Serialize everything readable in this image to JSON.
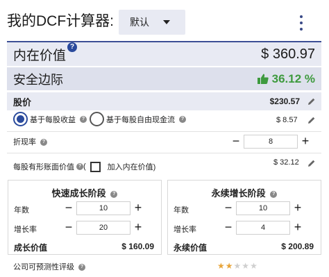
{
  "header": {
    "title": "我的DCF计算器:",
    "preset_value": "默认"
  },
  "intrinsic_value": {
    "label": "内在价值",
    "value": "$ 360.97"
  },
  "margin_of_safety": {
    "label": "安全边际",
    "value": "36.12 %",
    "color": "#3e9a3e"
  },
  "stock_price": {
    "label": "股价",
    "value": "$230.57"
  },
  "basis": {
    "option_eps": "基于每股收益",
    "option_fcf": "基于每股自由现金流",
    "selected": "eps",
    "value": "$ 8.57"
  },
  "discount_rate": {
    "label": "折现率",
    "value": "8"
  },
  "tangible_book": {
    "label": "每股有形账面价值",
    "paren_open": "(",
    "checkbox_label": "加入内在价值)",
    "value": "$ 32.12"
  },
  "growth_stage": {
    "title": "快速成长阶段",
    "years_label": "年数",
    "years_value": "10",
    "rate_label": "增长率",
    "rate_value": "20",
    "result_label": "成长价值",
    "result_value": "$ 160.09"
  },
  "terminal_stage": {
    "title": "永续增长阶段",
    "years_label": "年数",
    "years_value": "10",
    "rate_label": "增长率",
    "rate_value": "4",
    "result_label": "永续价值",
    "result_value": "$ 200.89"
  },
  "predictability": {
    "label": "公司可预测性评级",
    "stars_filled": 2,
    "stars_total": 5
  },
  "stepper_symbols": {
    "minus": "−",
    "plus": "+"
  },
  "colors": {
    "accent": "#2a4a9c",
    "star_on": "#e8a53a",
    "star_off": "#cfcfcf"
  }
}
